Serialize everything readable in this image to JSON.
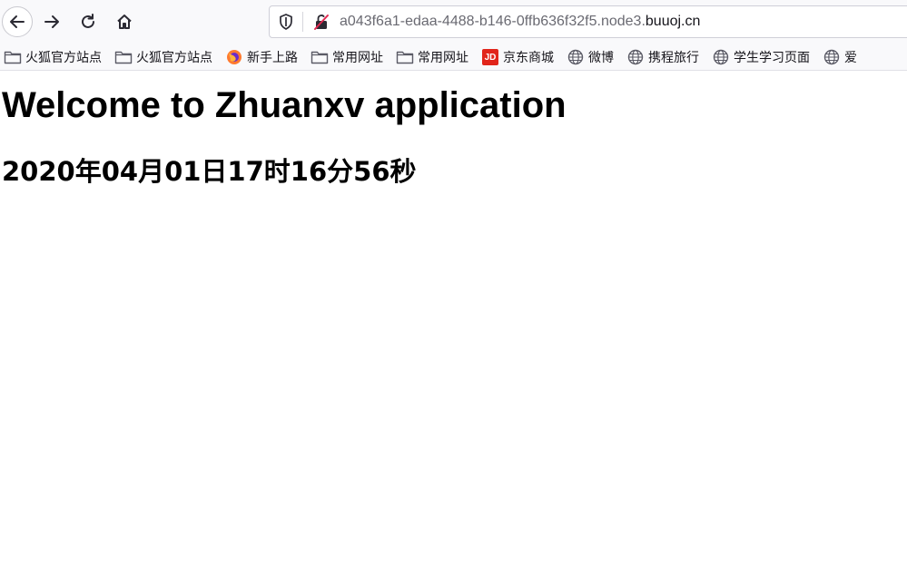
{
  "browser": {
    "url_subdomain": "a043f6a1-edaa-4488-b146-0ffb636f32f5.node3.",
    "url_host": "buuoj.cn"
  },
  "bookmarks": [
    {
      "label": "火狐官方站点",
      "icon": "folder-icon"
    },
    {
      "label": "火狐官方站点",
      "icon": "folder-icon"
    },
    {
      "label": "新手上路",
      "icon": "firefox-icon"
    },
    {
      "label": "常用网址",
      "icon": "folder-icon"
    },
    {
      "label": "常用网址",
      "icon": "folder-icon"
    },
    {
      "label": "京东商城",
      "icon": "jd-icon",
      "icon_text": "JD"
    },
    {
      "label": "微博",
      "icon": "globe-icon"
    },
    {
      "label": "携程旅行",
      "icon": "globe-icon"
    },
    {
      "label": "学生学习页面",
      "icon": "globe-icon"
    },
    {
      "label": "爱",
      "icon": "globe-icon"
    }
  ],
  "page": {
    "heading": "Welcome to Zhuanxv application",
    "datetime": "2020年04月01日17时16分56秒"
  }
}
